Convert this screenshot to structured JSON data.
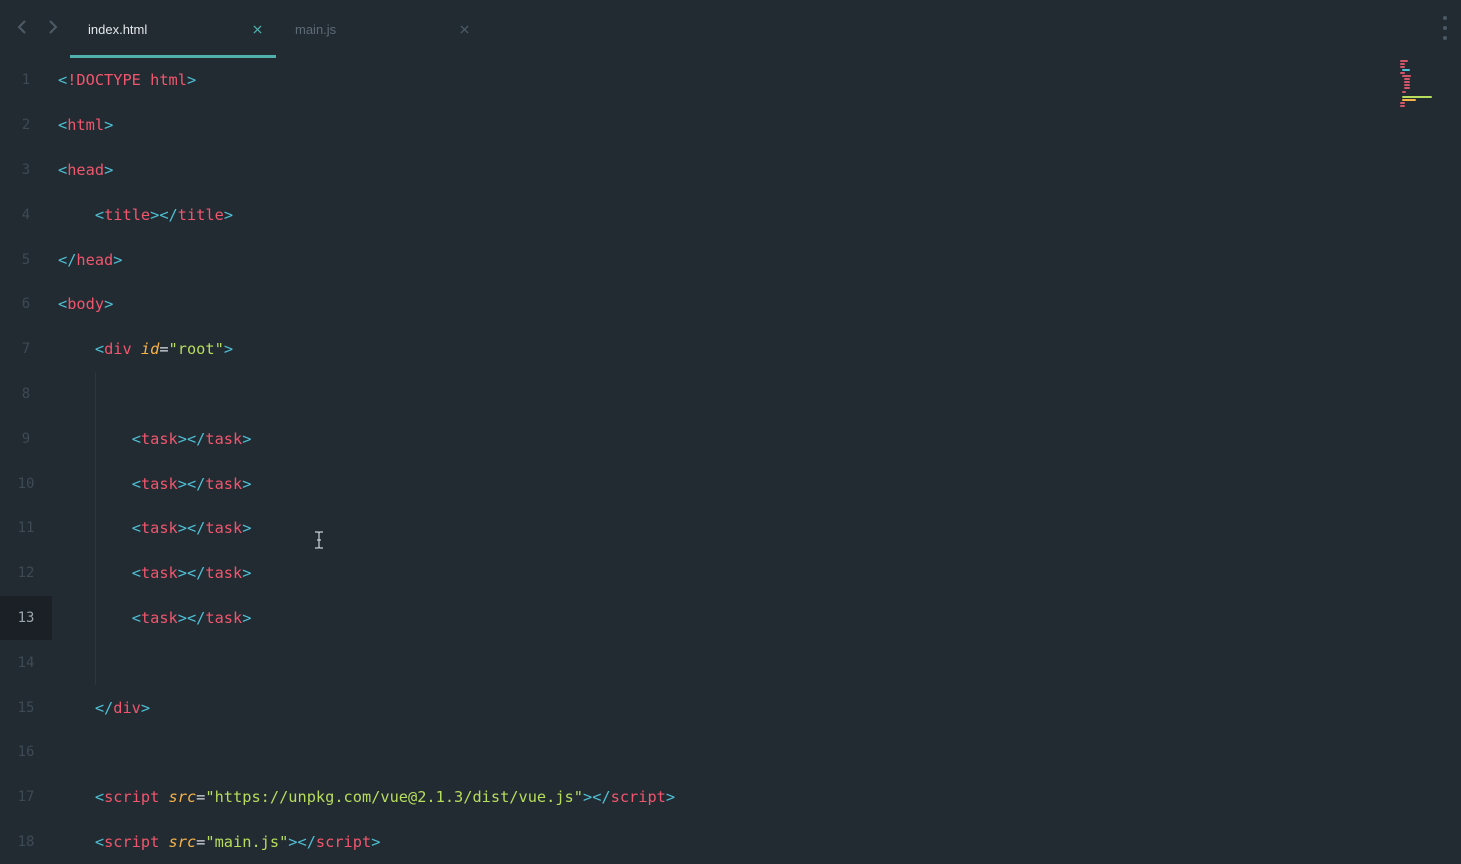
{
  "tabs": [
    {
      "label": "index.html",
      "active": true
    },
    {
      "label": "main.js",
      "active": false
    }
  ],
  "lines": [
    {
      "n": "1",
      "tokens": [
        [
          "p",
          "<"
        ],
        [
          "t",
          "!DOCTYPE html"
        ],
        [
          "p",
          ">"
        ]
      ]
    },
    {
      "n": "2",
      "tokens": [
        [
          "p",
          "<"
        ],
        [
          "t",
          "html"
        ],
        [
          "p",
          ">"
        ]
      ]
    },
    {
      "n": "3",
      "tokens": [
        [
          "p",
          "<"
        ],
        [
          "t",
          "head"
        ],
        [
          "p",
          ">"
        ]
      ]
    },
    {
      "n": "4",
      "tokens": [
        [
          "x",
          "    "
        ],
        [
          "p",
          "<"
        ],
        [
          "t",
          "title"
        ],
        [
          "p",
          "></"
        ],
        [
          "t",
          "title"
        ],
        [
          "p",
          ">"
        ]
      ]
    },
    {
      "n": "5",
      "tokens": [
        [
          "p",
          "</"
        ],
        [
          "t",
          "head"
        ],
        [
          "p",
          ">"
        ]
      ]
    },
    {
      "n": "6",
      "tokens": [
        [
          "p",
          "<"
        ],
        [
          "t",
          "body"
        ],
        [
          "p",
          ">"
        ]
      ]
    },
    {
      "n": "7",
      "tokens": [
        [
          "x",
          "    "
        ],
        [
          "p",
          "<"
        ],
        [
          "t",
          "div "
        ],
        [
          "a",
          "id"
        ],
        [
          "x",
          "="
        ],
        [
          "s",
          "\"root\""
        ],
        [
          "p",
          ">"
        ]
      ]
    },
    {
      "n": "8",
      "tokens": []
    },
    {
      "n": "9",
      "tokens": [
        [
          "x",
          "        "
        ],
        [
          "p",
          "<"
        ],
        [
          "t",
          "task"
        ],
        [
          "p",
          "></"
        ],
        [
          "t",
          "task"
        ],
        [
          "p",
          ">"
        ]
      ]
    },
    {
      "n": "10",
      "tokens": [
        [
          "x",
          "        "
        ],
        [
          "p",
          "<"
        ],
        [
          "t",
          "task"
        ],
        [
          "p",
          "></"
        ],
        [
          "t",
          "task"
        ],
        [
          "p",
          ">"
        ]
      ]
    },
    {
      "n": "11",
      "tokens": [
        [
          "x",
          "        "
        ],
        [
          "p",
          "<"
        ],
        [
          "t",
          "task"
        ],
        [
          "p",
          "></"
        ],
        [
          "t",
          "task"
        ],
        [
          "p",
          ">"
        ]
      ]
    },
    {
      "n": "12",
      "tokens": [
        [
          "x",
          "        "
        ],
        [
          "p",
          "<"
        ],
        [
          "t",
          "task"
        ],
        [
          "p",
          "></"
        ],
        [
          "t",
          "task"
        ],
        [
          "p",
          ">"
        ]
      ]
    },
    {
      "n": "13",
      "tokens": [
        [
          "x",
          "        "
        ],
        [
          "p",
          "<"
        ],
        [
          "t",
          "task"
        ],
        [
          "p",
          "></"
        ],
        [
          "t",
          "task"
        ],
        [
          "p",
          ">"
        ]
      ],
      "current": true
    },
    {
      "n": "14",
      "tokens": []
    },
    {
      "n": "15",
      "tokens": [
        [
          "x",
          "    "
        ],
        [
          "p",
          "</"
        ],
        [
          "t",
          "div"
        ],
        [
          "p",
          ">"
        ]
      ]
    },
    {
      "n": "16",
      "tokens": []
    },
    {
      "n": "17",
      "tokens": [
        [
          "x",
          "    "
        ],
        [
          "p",
          "<"
        ],
        [
          "t",
          "script "
        ],
        [
          "a",
          "src"
        ],
        [
          "x",
          "="
        ],
        [
          "s",
          "\"https://unpkg.com/vue@2.1.3/dist/vue.js\""
        ],
        [
          "p",
          "></"
        ],
        [
          "t",
          "script"
        ],
        [
          "p",
          ">"
        ]
      ]
    },
    {
      "n": "18",
      "tokens": [
        [
          "x",
          "    "
        ],
        [
          "p",
          "<"
        ],
        [
          "t",
          "script "
        ],
        [
          "a",
          "src"
        ],
        [
          "x",
          "="
        ],
        [
          "s",
          "\"main.js\""
        ],
        [
          "p",
          "></"
        ],
        [
          "t",
          "script"
        ],
        [
          "p",
          ">"
        ]
      ]
    }
  ],
  "colors": {
    "background": "#232b32",
    "punctuation": "#4ec1d6",
    "tag": "#f0566d",
    "attribute": "#f5b348",
    "string": "#b6dd5c",
    "tab_accent": "#4fb0ad"
  },
  "icons": {
    "back": "chevron-left-icon",
    "forward": "chevron-right-icon",
    "close": "close-icon",
    "more": "more-vertical-icon",
    "cursor": "text-cursor-icon"
  }
}
